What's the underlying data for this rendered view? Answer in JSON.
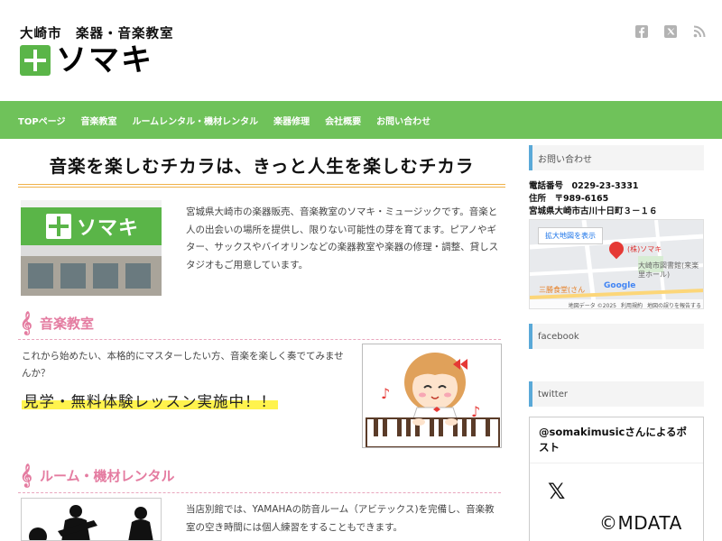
{
  "header": {
    "tagline": "大崎市　楽器・音楽教室",
    "logo_text": "ソマキ",
    "social": [
      "facebook-icon",
      "twitter-icon",
      "rss-icon"
    ]
  },
  "nav": {
    "items": [
      "TOPページ",
      "音楽教室",
      "ルームレンタル・機材レンタル",
      "楽器修理",
      "会社概要",
      "お問い合わせ"
    ]
  },
  "main": {
    "hero": "音楽を楽しむチカラは、きっと人生を楽しむチカラ",
    "store_sign": "ソマキ",
    "intro": "宮城県大崎市の楽器販売、音楽教室のソマキ・ミュージックです。音楽と人の出会いの場所を提供し、限りない可能性の芽を育てます。ピアノやギター、サックスやバイオリンなどの楽器教室や楽器の修理・調整、貸しスタジオもご用意しています。",
    "lesson": {
      "title": "音楽教室",
      "text": "これから始めたい、本格的にマスターしたい方、音楽を楽しく奏でてみませんか？",
      "highlight": "見学・無料体験レッスン実施中！！"
    },
    "rental": {
      "title": "ルーム・機材レンタル",
      "text": "当店別館では、YAMAHAの防音ルーム（アビテックス)を完備し、音楽教室の空き時間には個人練習をすることもできます。"
    }
  },
  "sidebar": {
    "contact_title": "お問い合わせ",
    "phone": "電話番号　0229-23-3331",
    "address_label": "住所　〒989-6165",
    "address": "宮城県大崎市古川十日町３－１６",
    "map": {
      "button": "拡大地図を表示",
      "pin_label": "(株)ソマキ",
      "poi_library": "大崎市図書館(来楽里ホール)",
      "poi_cafe": "三勝食堂(さん",
      "google": "Google",
      "footer": [
        "地図データ ©2025",
        "利用規約",
        "地図の誤りを報告する"
      ]
    },
    "facebook_title": "facebook",
    "twitter_title": "twitter",
    "twitter_embed_title": "@somakimusicさんによるポスト"
  },
  "watermark": "©MDATA",
  "colors": {
    "nav_bg": "#6fc25a",
    "brand_green": "#5ab548",
    "section_pink": "#e47ba0",
    "widget_accent": "#5aa9d8"
  }
}
